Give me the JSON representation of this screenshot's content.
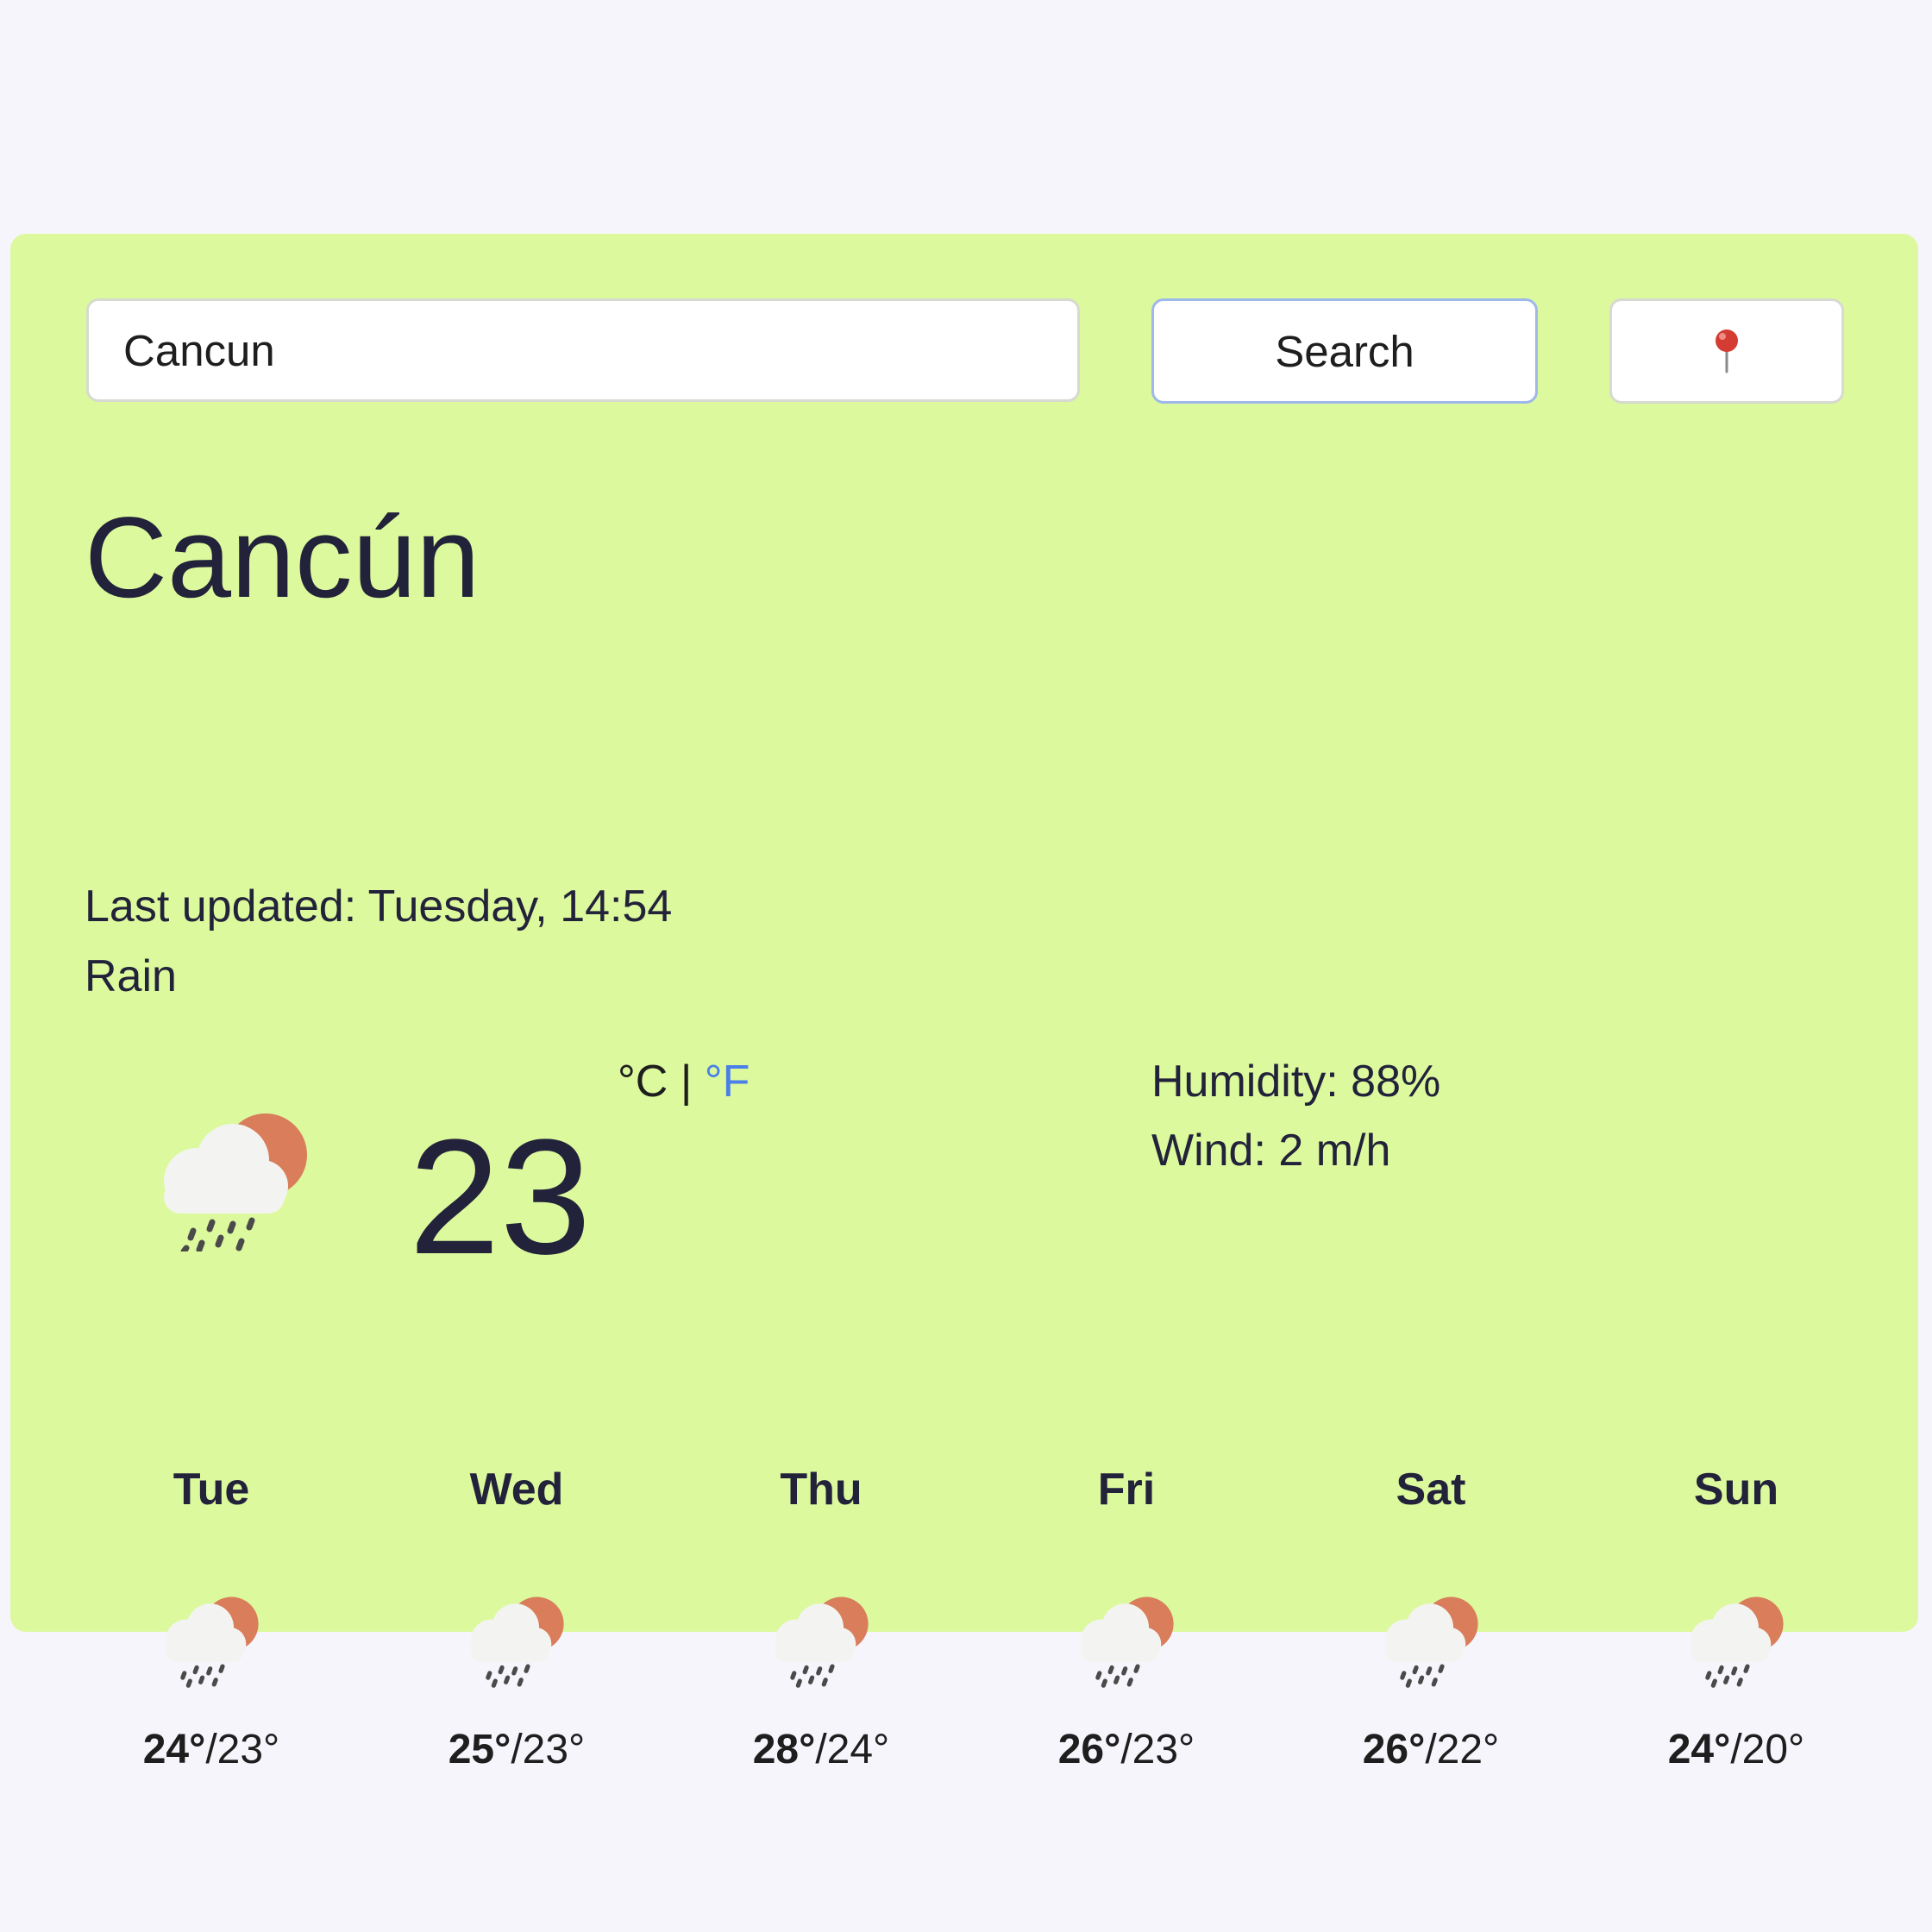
{
  "search": {
    "value": "Cancun",
    "button_label": "Search",
    "location_icon": "pushpin-icon"
  },
  "current": {
    "city": "Cancún",
    "last_updated": "Last updated: Tuesday, 14:54",
    "condition": "Rain",
    "icon": "rain-sun-cloud-icon",
    "temperature": "23",
    "unit_c": "°C",
    "unit_separator": "|",
    "unit_f": "°F",
    "humidity": "Humidity: 88%",
    "wind": "Wind: 2 m/h"
  },
  "forecast": [
    {
      "day": "Tue",
      "max": "24°",
      "min": "/23°",
      "icon": "rain-sun-cloud-icon"
    },
    {
      "day": "Wed",
      "max": "25°",
      "min": "/23°",
      "icon": "rain-sun-cloud-icon"
    },
    {
      "day": "Thu",
      "max": "28°",
      "min": "/24°",
      "icon": "rain-sun-cloud-icon"
    },
    {
      "day": "Fri",
      "max": "26°",
      "min": "/23°",
      "icon": "rain-sun-cloud-icon"
    },
    {
      "day": "Sat",
      "max": "26°",
      "min": "/22°",
      "icon": "rain-sun-cloud-icon"
    },
    {
      "day": "Sun",
      "max": "24°",
      "min": "/20°",
      "icon": "rain-sun-cloud-icon"
    }
  ],
  "colors": {
    "page_background": "#f7f5fc",
    "card_background": "#dcf99d",
    "text": "#22223a",
    "link_unit": "#4a7fe8",
    "sun": "#d97d5b",
    "cloud": "#f3f4f1",
    "rain": "#4a4a4a"
  }
}
